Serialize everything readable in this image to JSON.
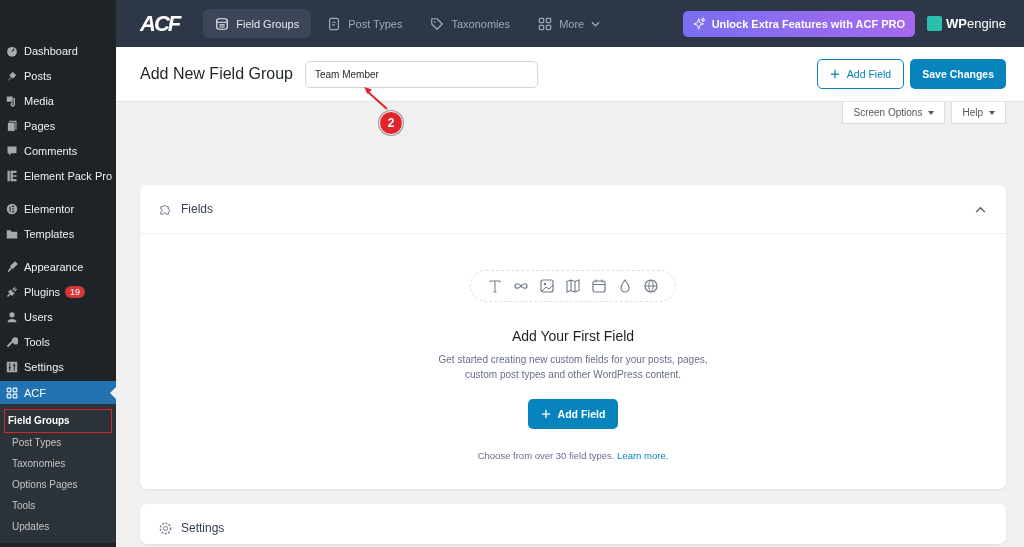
{
  "sidebar": {
    "groups": [
      {
        "items": [
          {
            "label": "Dashboard",
            "selected": false
          },
          {
            "label": "Posts",
            "selected": false
          },
          {
            "label": "Media",
            "selected": false
          },
          {
            "label": "Pages",
            "selected": false
          },
          {
            "label": "Comments",
            "selected": false
          },
          {
            "label": "Element Pack Pro",
            "selected": false
          }
        ]
      },
      {
        "items": [
          {
            "label": "Elementor",
            "selected": false
          },
          {
            "label": "Templates",
            "selected": false
          }
        ]
      },
      {
        "items": [
          {
            "label": "Appearance",
            "selected": false
          },
          {
            "label": "Plugins",
            "selected": false,
            "badge": "19"
          },
          {
            "label": "Users",
            "selected": false
          },
          {
            "label": "Tools",
            "selected": false
          },
          {
            "label": "Settings",
            "selected": false
          },
          {
            "label": "ACF",
            "selected": true,
            "submenu": [
              {
                "label": "Field Groups",
                "selected": true,
                "highlighted": true
              },
              {
                "label": "Post Types",
                "selected": false,
                "highlighted": false
              },
              {
                "label": "Taxonomies",
                "selected": false,
                "highlighted": false
              },
              {
                "label": "Options Pages",
                "selected": false,
                "highlighted": false
              },
              {
                "label": "Tools",
                "selected": false,
                "highlighted": false
              },
              {
                "label": "Updates",
                "selected": false,
                "highlighted": false
              }
            ]
          }
        ]
      }
    ]
  },
  "topbar": {
    "logo": "ACF",
    "tabs": [
      {
        "label": "Field Groups",
        "selected": true,
        "dropdown": false
      },
      {
        "label": "Post Types",
        "selected": false,
        "dropdown": false
      },
      {
        "label": "Taxonomies",
        "selected": false,
        "dropdown": false
      },
      {
        "label": "More",
        "selected": false,
        "dropdown": true
      }
    ],
    "promo_button": "Unlock Extra Features with ACF PRO",
    "partner_logo": {
      "bold": "WP",
      "light": "engine"
    }
  },
  "header": {
    "title": "Add New Field Group",
    "title_value": "Team Member",
    "add_field_button": "Add Field",
    "save_button": "Save Changes"
  },
  "screen_tabs": [
    "Screen Options",
    "Help"
  ],
  "annotation": {
    "step": "2"
  },
  "fields_panel": {
    "title": "Fields",
    "expanded": true,
    "empty_title": "Add Your First Field",
    "empty_text": "Get started creating new custom fields for your posts, pages,\ncustom post types and other WordPress content.",
    "add_button": "Add Field",
    "footer_text": "Choose from over 30 field types.",
    "footer_link": "Learn more."
  },
  "settings_panel": {
    "title": "Settings"
  }
}
